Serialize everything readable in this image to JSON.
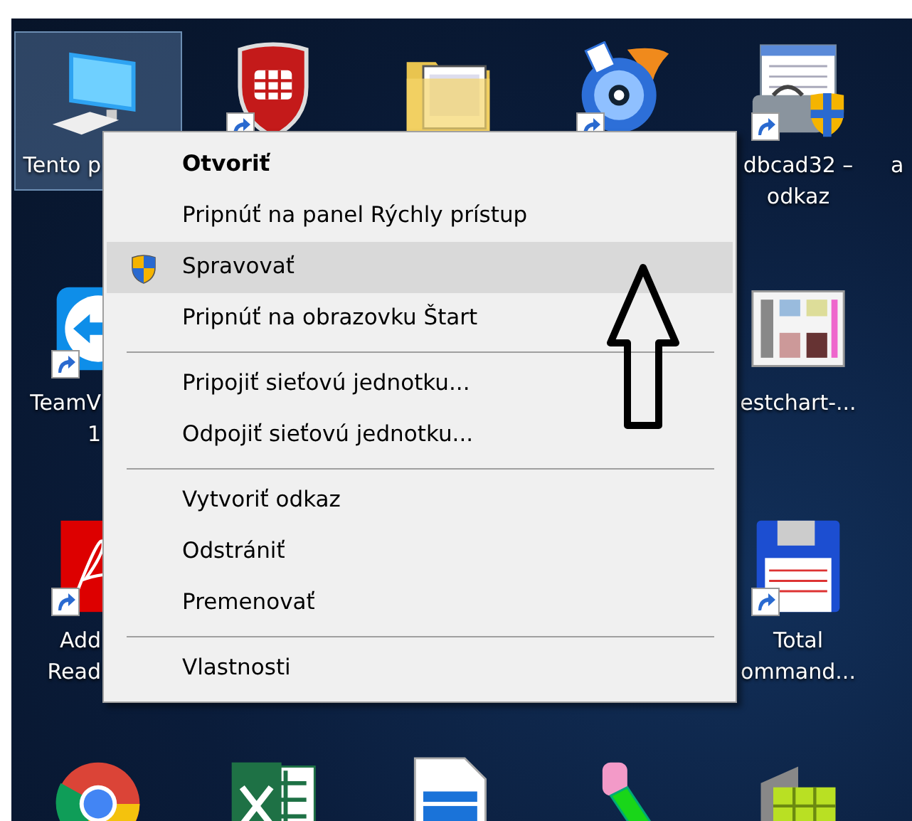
{
  "desktop": {
    "rows": [
      {
        "icons": [
          {
            "selected": true,
            "label": [
              "Tento p"
            ]
          },
          {
            "selected": false,
            "shortcut": true
          },
          {
            "selected": false
          },
          {
            "selected": false,
            "shortcut": true
          },
          {
            "selected": false,
            "shortcut": true,
            "label": [
              "dbcad32 –",
              "odkaz"
            ]
          },
          {
            "selected": false,
            "label": [
              "a"
            ]
          }
        ]
      },
      {
        "icons": [
          {
            "selected": false,
            "shortcut": true,
            "label": [
              "TeamV",
              "1"
            ]
          },
          {
            "selected": false,
            "label": [
              "estchart-..."
            ]
          }
        ]
      },
      {
        "icons": [
          {
            "selected": false,
            "shortcut": true,
            "label": [
              "Add",
              "Read"
            ]
          },
          {
            "selected": false,
            "shortcut": true,
            "label": [
              "Total",
              "ommand..."
            ]
          }
        ]
      },
      {
        "icons": [
          {
            "selected": false
          },
          {
            "selected": false
          },
          {
            "selected": false
          },
          {
            "selected": false
          },
          {
            "selected": false
          }
        ]
      }
    ]
  },
  "context_menu": {
    "items": [
      {
        "kind": "command",
        "label": "Otvoriť",
        "default": true,
        "elevated": false,
        "selected": false
      },
      {
        "kind": "command",
        "label": "Pripnúť na panel Rýchly prístup",
        "default": false,
        "elevated": false,
        "selected": false
      },
      {
        "kind": "command",
        "label": "Spravovať",
        "default": false,
        "elevated": true,
        "selected": true
      },
      {
        "kind": "command",
        "label": "Pripnúť na obrazovku Štart",
        "default": false,
        "elevated": false,
        "selected": false
      },
      {
        "kind": "separator"
      },
      {
        "kind": "command",
        "label": "Pripojiť sieťovú jednotku...",
        "default": false,
        "elevated": false,
        "selected": false
      },
      {
        "kind": "command",
        "label": "Odpojiť sieťovú jednotku...",
        "default": false,
        "elevated": false,
        "selected": false
      },
      {
        "kind": "separator"
      },
      {
        "kind": "command",
        "label": "Vytvoriť odkaz",
        "default": false,
        "elevated": false,
        "selected": false
      },
      {
        "kind": "command",
        "label": "Odstrániť",
        "default": false,
        "elevated": false,
        "selected": false
      },
      {
        "kind": "command",
        "label": "Premenovať",
        "default": false,
        "elevated": false,
        "selected": false
      },
      {
        "kind": "separator"
      },
      {
        "kind": "command",
        "label": "Vlastnosti",
        "default": false,
        "elevated": false,
        "selected": false
      }
    ]
  },
  "annotations": [
    {
      "kind": "up_arrow"
    }
  ]
}
